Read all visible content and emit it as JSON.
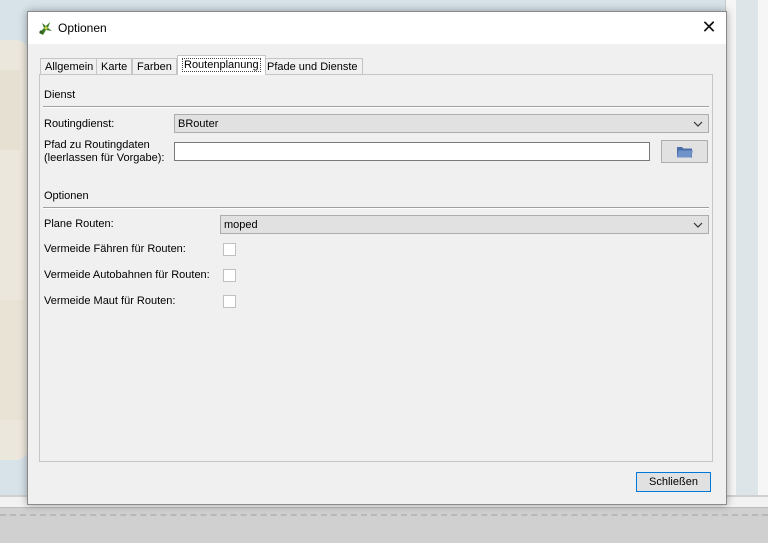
{
  "window": {
    "title": "Optionen",
    "close_glyph": "✕"
  },
  "tabs": [
    {
      "label": "Allgemein"
    },
    {
      "label": "Karte"
    },
    {
      "label": "Farben"
    },
    {
      "label": "Routenplanung",
      "active": true
    },
    {
      "label": "Pfade und Dienste"
    }
  ],
  "dienst": {
    "section_title": "Dienst",
    "routing_service_label": "Routingdienst:",
    "routing_service_value": "BRouter",
    "path_label_line1": "Pfad zu Routingdaten",
    "path_label_line2": "(leerlassen für Vorgabe):",
    "path_value": ""
  },
  "optionen": {
    "section_title": "Optionen",
    "plan_routes_label": "Plane Routen:",
    "plan_routes_value": "moped",
    "avoid_ferries_label": "Vermeide Fähren für Routen:",
    "avoid_ferries_checked": false,
    "avoid_highways_label": "Vermeide Autobahnen für Routen:",
    "avoid_highways_checked": false,
    "avoid_tolls_label": "Vermeide Maut für Routen:",
    "avoid_tolls_checked": false
  },
  "footer": {
    "close_label": "Schließen"
  },
  "icons": {
    "app": "app-icon",
    "folder": "folder-icon",
    "dropdown": "chevron-down-icon"
  },
  "colors": {
    "accent": "#0078d7"
  }
}
